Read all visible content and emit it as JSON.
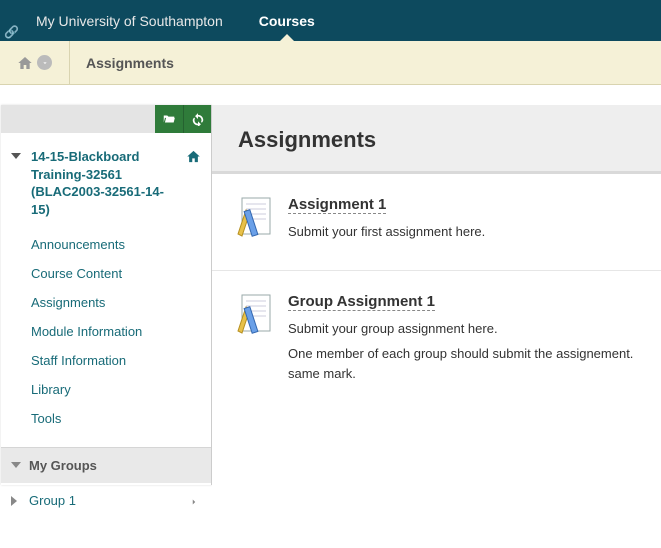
{
  "topnav": {
    "items": [
      {
        "label": "My University of Southampton",
        "active": false
      },
      {
        "label": "Courses",
        "active": true
      }
    ]
  },
  "breadcrumb": {
    "title": "Assignments"
  },
  "sidebar": {
    "course_title": "14-15-Blackboard Training-32561 (BLAC2003-32561-14-15)",
    "nav": [
      "Announcements",
      "Course Content",
      "Assignments",
      "Module Information",
      "Staff Information",
      "Library",
      "Tools"
    ],
    "groups_header": "My Groups",
    "groups": [
      "Group 1"
    ]
  },
  "content": {
    "heading": "Assignments",
    "items": [
      {
        "title": "Assignment 1",
        "lines": [
          "Submit your first assignment here."
        ]
      },
      {
        "title": "Group Assignment 1",
        "lines": [
          "Submit your group assignment here.",
          "One member of each group should submit the assignement. same mark."
        ]
      }
    ]
  }
}
